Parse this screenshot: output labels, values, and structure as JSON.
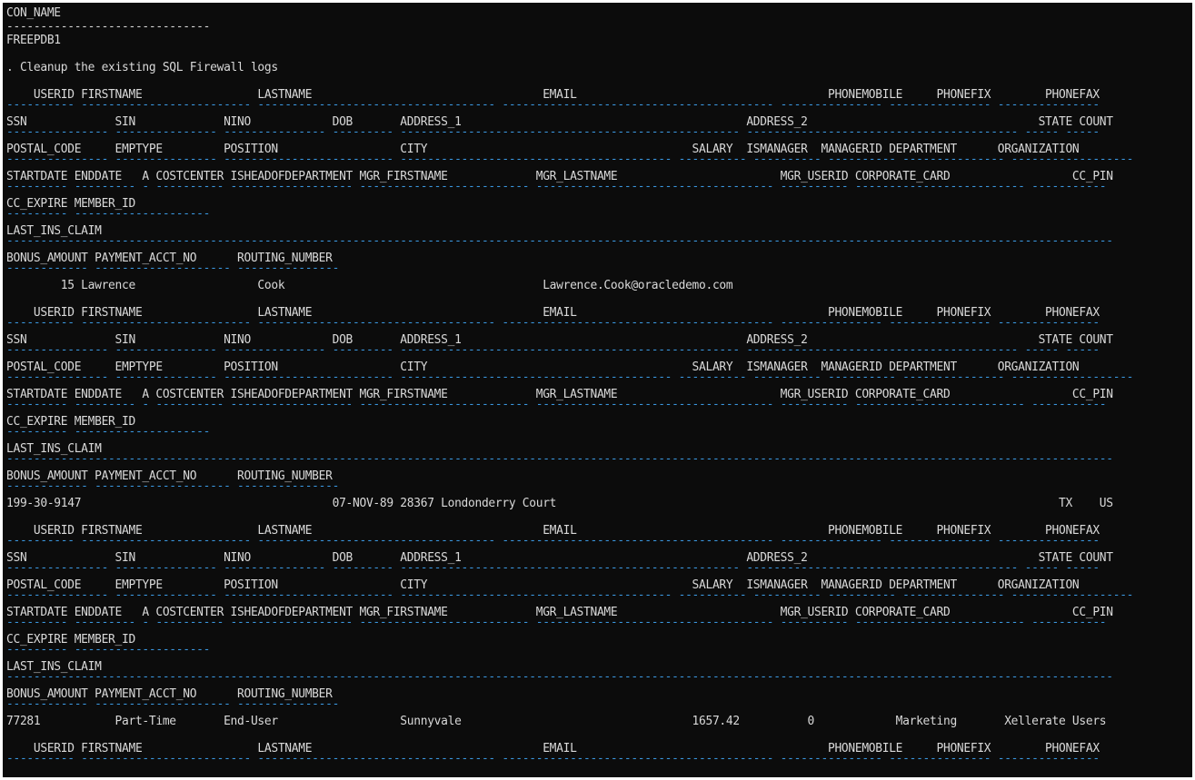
{
  "lines": [
    {
      "t": "CON_NAME"
    },
    {
      "t": "------------------------------",
      "kind": "plain-dash"
    },
    {
      "t": "FREEPDB1"
    },
    {
      "t": ""
    },
    {
      "t": ". Cleanup the existing SQL Firewall logs"
    },
    {
      "t": ""
    },
    {
      "t": "    USERID FIRSTNAME                 LASTNAME                                  EMAIL                                     PHONEMOBILE     PHONEFIX        PHONEFAX"
    },
    {
      "t": "---------- ------------------------- ----------------------------------- ---------------------------------------- --------------- --------------- ---------------",
      "kind": "dash"
    },
    {
      "t": "SSN             SIN             NINO            DOB       ADDRESS_1                                          ADDRESS_2                                  STATE COUNT"
    },
    {
      "t": "--------------- --------------- --------------- --------- -------------------------------------------------- ---------------------------------------- ----- -----",
      "kind": "dash"
    },
    {
      "t": "POSTAL_CODE     EMPTYPE         POSITION                  CITY                                       SALARY  ISMANAGER  MANAGERID DEPARTMENT      ORGANIZATION"
    },
    {
      "t": "--------------- --------------- ------------------------- ---------------------------------------- ---------- ---------- ---------- --------------- ------------------",
      "kind": "dash"
    },
    {
      "t": "STARTDATE ENDDATE   A COSTCENTER ISHEADOFDEPARTMENT MGR_FIRSTNAME             MGR_LASTNAME                        MGR_USERID CORPORATE_CARD                  CC_PIN"
    },
    {
      "t": "--------- --------- - ---------- ------------------ ------------------------- ----------------------------------- ---------- ------------------------- -----------",
      "kind": "dash"
    },
    {
      "t": "CC_EXPIRE MEMBER_ID"
    },
    {
      "t": "--------- --------------------",
      "kind": "dash"
    },
    {
      "t": "LAST_INS_CLAIM"
    },
    {
      "t": "-------------------------------------------------------------------------------------------------------------------------------------------------------------------",
      "kind": "dash"
    },
    {
      "t": "BONUS_AMOUNT PAYMENT_ACCT_NO      ROUTING_NUMBER"
    },
    {
      "t": "------------ -------------------- ---------------",
      "kind": "dash"
    },
    {
      "t": "        15 Lawrence                  Cook                                      Lawrence.Cook@oracledemo.com"
    },
    {
      "t": ""
    },
    {
      "t": "    USERID FIRSTNAME                 LASTNAME                                  EMAIL                                     PHONEMOBILE     PHONEFIX        PHONEFAX"
    },
    {
      "t": "---------- ------------------------- ----------------------------------- ---------------------------------------- --------------- --------------- ---------------",
      "kind": "dash"
    },
    {
      "t": "SSN             SIN             NINO            DOB       ADDRESS_1                                          ADDRESS_2                                  STATE COUNT"
    },
    {
      "t": "--------------- --------------- --------------- --------- -------------------------------------------------- ---------------------------------------- ----- -----",
      "kind": "dash"
    },
    {
      "t": "POSTAL_CODE     EMPTYPE         POSITION                  CITY                                       SALARY  ISMANAGER  MANAGERID DEPARTMENT      ORGANIZATION"
    },
    {
      "t": "--------------- --------------- ------------------------- ---------------------------------------- ---------- ---------- ---------- --------------- ------------------",
      "kind": "dash"
    },
    {
      "t": "STARTDATE ENDDATE   A COSTCENTER ISHEADOFDEPARTMENT MGR_FIRSTNAME             MGR_LASTNAME                        MGR_USERID CORPORATE_CARD                  CC_PIN"
    },
    {
      "t": "--------- --------- - ---------- ------------------ ------------------------- ----------------------------------- ---------- ------------------------- -----------",
      "kind": "dash"
    },
    {
      "t": "CC_EXPIRE MEMBER_ID"
    },
    {
      "t": "--------- --------------------",
      "kind": "dash"
    },
    {
      "t": "LAST_INS_CLAIM"
    },
    {
      "t": "-------------------------------------------------------------------------------------------------------------------------------------------------------------------",
      "kind": "dash"
    },
    {
      "t": "BONUS_AMOUNT PAYMENT_ACCT_NO      ROUTING_NUMBER"
    },
    {
      "t": "------------ -------------------- ---------------",
      "kind": "dash"
    },
    {
      "t": "199-30-9147                                     07-NOV-89 28367 Londonderry Court                                                                          TX    US"
    },
    {
      "t": ""
    },
    {
      "t": "    USERID FIRSTNAME                 LASTNAME                                  EMAIL                                     PHONEMOBILE     PHONEFIX        PHONEFAX"
    },
    {
      "t": "---------- ------------------------- ----------------------------------- ---------------------------------------- --------------- --------------- ---------------",
      "kind": "dash"
    },
    {
      "t": "SSN             SIN             NINO            DOB       ADDRESS_1                                          ADDRESS_2                                  STATE COUNT"
    },
    {
      "t": "--------------- --------------- --------------- --------- -------------------------------------------------- ---------------------------------------- ----- -----",
      "kind": "dash"
    },
    {
      "t": "POSTAL_CODE     EMPTYPE         POSITION                  CITY                                       SALARY  ISMANAGER  MANAGERID DEPARTMENT      ORGANIZATION"
    },
    {
      "t": "--------------- --------------- ------------------------- ---------------------------------------- ---------- ---------- ---------- --------------- ------------------",
      "kind": "dash"
    },
    {
      "t": "STARTDATE ENDDATE   A COSTCENTER ISHEADOFDEPARTMENT MGR_FIRSTNAME             MGR_LASTNAME                        MGR_USERID CORPORATE_CARD                  CC_PIN"
    },
    {
      "t": "--------- --------- - ---------- ------------------ ------------------------- ----------------------------------- ---------- ------------------------- -----------",
      "kind": "dash"
    },
    {
      "t": "CC_EXPIRE MEMBER_ID"
    },
    {
      "t": "--------- --------------------",
      "kind": "dash"
    },
    {
      "t": "LAST_INS_CLAIM"
    },
    {
      "t": "-------------------------------------------------------------------------------------------------------------------------------------------------------------------",
      "kind": "dash"
    },
    {
      "t": "BONUS_AMOUNT PAYMENT_ACCT_NO      ROUTING_NUMBER"
    },
    {
      "t": "------------ -------------------- ---------------",
      "kind": "dash"
    },
    {
      "t": "77281           Part-Time       End-User                  Sunnyvale                                  1657.42          0            Marketing       Xellerate Users"
    },
    {
      "t": ""
    },
    {
      "t": "    USERID FIRSTNAME                 LASTNAME                                  EMAIL                                     PHONEMOBILE     PHONEFIX        PHONEFAX"
    },
    {
      "t": "---------- ------------------------- ----------------------------------- ---------------------------------------- --------------- --------------- ---------------",
      "kind": "dash"
    },
    {
      "t": ""
    }
  ],
  "colors": {
    "background": "#0c0c0c",
    "text": "#d9d9d9",
    "separator": "#3a96dd"
  }
}
